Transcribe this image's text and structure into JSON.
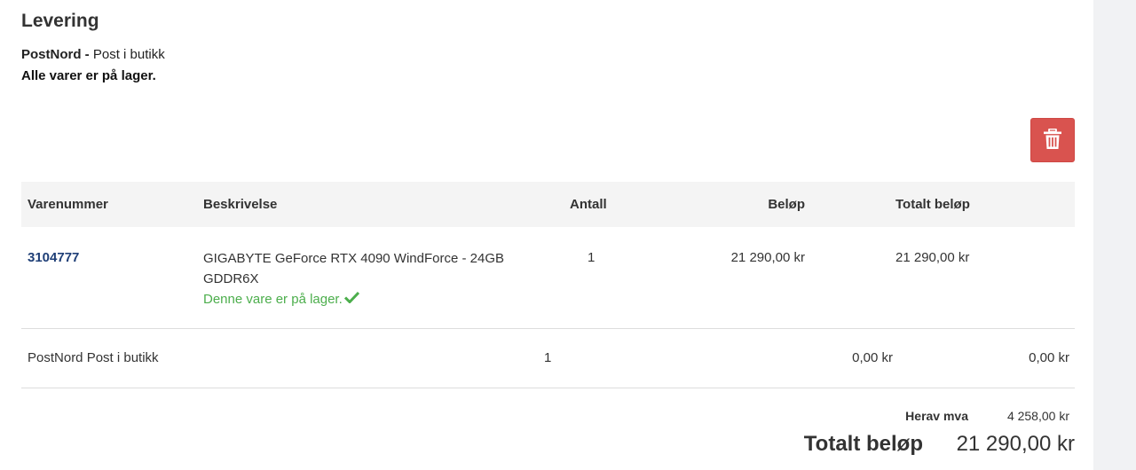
{
  "delivery": {
    "title": "Levering",
    "carrier_name": "PostNord",
    "carrier_separator": " - ",
    "carrier_method": "Post i butikk",
    "stock_status": "Alle varer er på lager."
  },
  "actions": {
    "delete_icon": "trash-icon",
    "delete_color": "#d9534f"
  },
  "table": {
    "headers": {
      "sku": "Varenummer",
      "description": "Beskrivelse",
      "quantity": "Antall",
      "amount": "Beløp",
      "total": "Totalt beløp"
    },
    "product": {
      "sku": "3104777",
      "description": "GIGABYTE GeForce RTX 4090 WindForce - 24GB GDDR6X",
      "stock_note": "Denne vare er på lager.",
      "stock_icon": "checkmark-icon",
      "quantity": "1",
      "amount": "21 290,00 kr",
      "total": "21 290,00 kr"
    },
    "shipping": {
      "description": "PostNord Post i butikk",
      "quantity": "1",
      "amount": "0,00 kr",
      "total": "0,00 kr"
    }
  },
  "summary": {
    "vat_label": "Herav mva",
    "vat_value": "4 258,00 kr",
    "total_label": "Totalt beløp",
    "total_value": "21 290,00 kr"
  },
  "colors": {
    "link": "#1f3f77",
    "in_stock": "#4cae4c",
    "header_bg": "#f4f4f4"
  }
}
